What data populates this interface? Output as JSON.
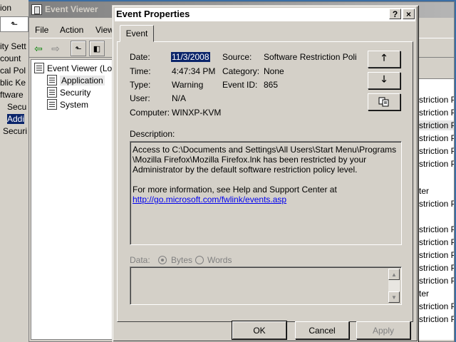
{
  "left_window": {
    "items": [
      "ion",
      "ity Sett",
      "count",
      "cal Pol",
      "blic Ke",
      "ftware",
      "Secu",
      "Addi",
      "Securi"
    ]
  },
  "event_viewer": {
    "title": "Event Viewer",
    "menu": [
      "File",
      "Action",
      "View"
    ],
    "tree": {
      "root": "Event Viewer (Loc",
      "items": [
        "Application",
        "Security",
        "System"
      ]
    },
    "right_column": [
      "striction P",
      "striction P",
      "striction P",
      "striction P",
      "striction P",
      "striction P",
      "ter",
      "striction P",
      "striction P",
      "striction P",
      "striction P",
      "striction P",
      "striction P",
      "ter",
      "striction P",
      "striction P"
    ]
  },
  "dialog": {
    "title": "Event Properties",
    "help_button": "?",
    "close_button": "×",
    "tab": "Event",
    "fields": {
      "date_label": "Date:",
      "date": "11/3/2008",
      "source_label": "Source:",
      "source": "Software Restriction Poli",
      "time_label": "Time:",
      "time": "4:47:34 PM",
      "category_label": "Category:",
      "category": "None",
      "type_label": "Type:",
      "type": "Warning",
      "event_id_label": "Event ID:",
      "event_id": "865",
      "user_label": "User:",
      "user": "N/A",
      "computer_label": "Computer:",
      "computer": "WINXP-KVM"
    },
    "description_label": "Description:",
    "description": "Access to C:\\Documents and Settings\\All Users\\Start Menu\\Programs \\Mozilla Firefox\\Mozilla Firefox.lnk has been restricted by your Administrator by the default software restriction policy level.",
    "help_text": "For more information, see Help and Support Center at",
    "help_link": "http://go.microsoft.com/fwlink/events.asp",
    "data_label": "Data:",
    "bytes_label": "Bytes",
    "words_label": "Words",
    "data_format_selected": "Bytes",
    "buttons": {
      "ok": "OK",
      "cancel": "Cancel",
      "apply": "Apply"
    },
    "nav_icons": [
      "up-arrow-icon",
      "down-arrow-icon",
      "copy-icon"
    ]
  }
}
